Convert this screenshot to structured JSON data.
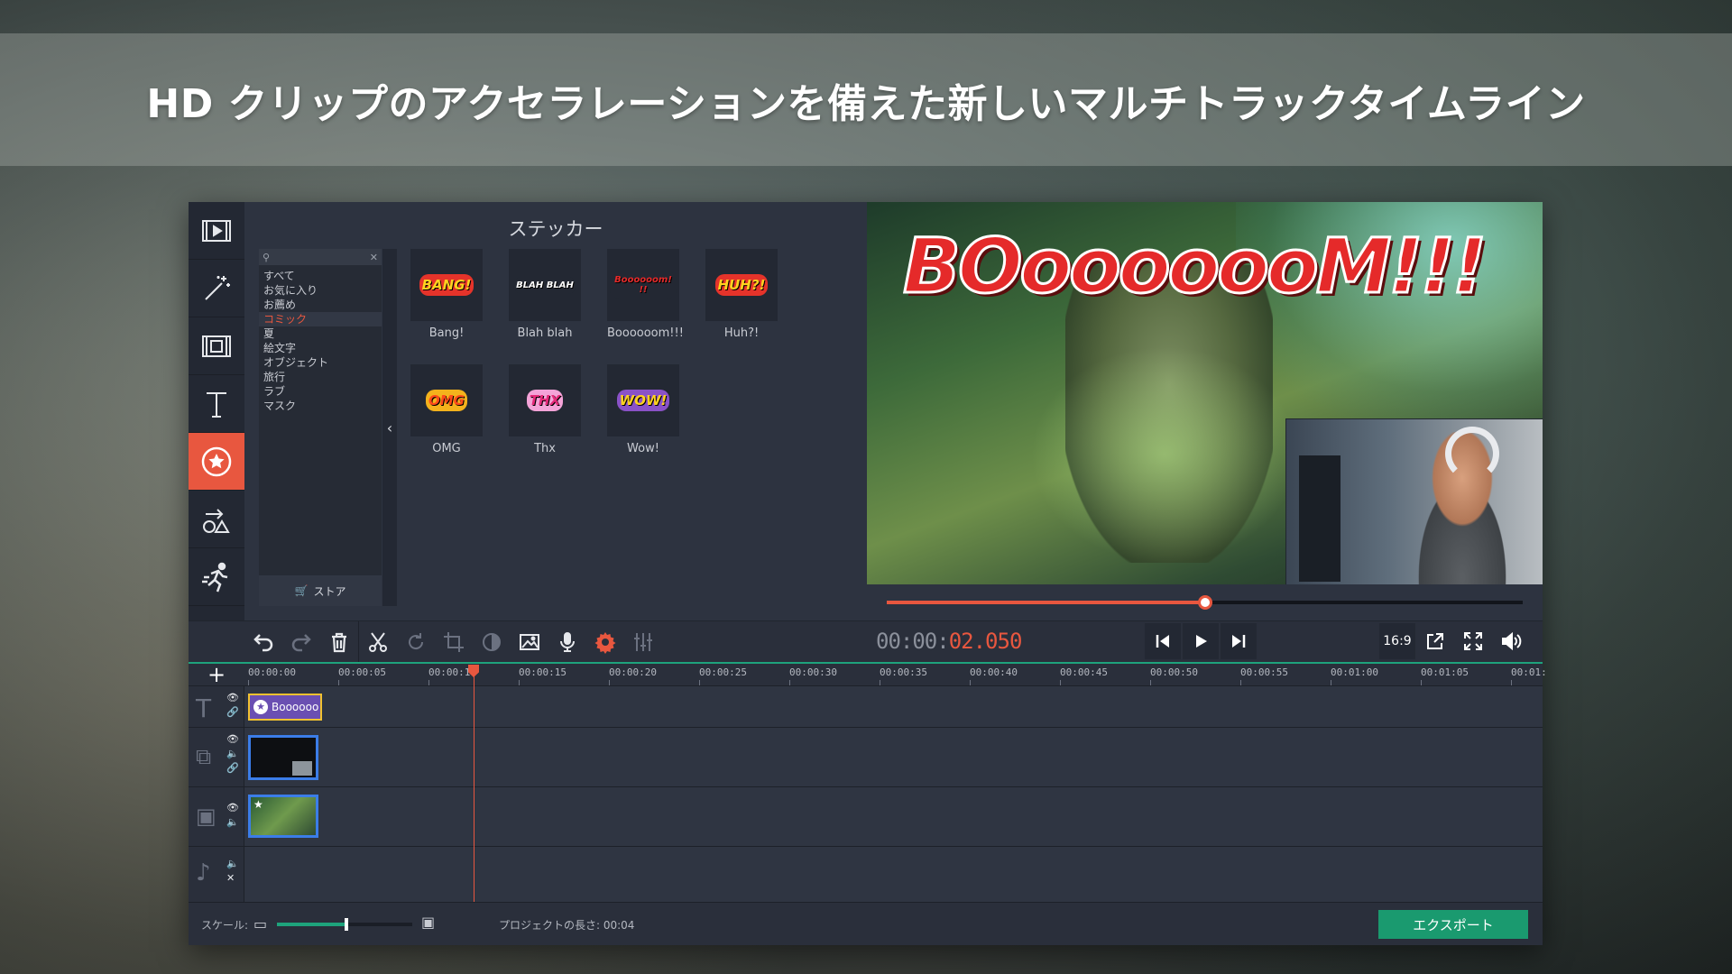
{
  "banner": {
    "headline": "HD クリップのアクセラレーションを備えた新しいマルチトラックタイムライン"
  },
  "rail": {
    "items": [
      {
        "name": "media-import",
        "icon": "film-import-icon",
        "active": false
      },
      {
        "name": "filters",
        "icon": "magic-wand-icon",
        "active": false
      },
      {
        "name": "transitions",
        "icon": "film-transition-icon",
        "active": false
      },
      {
        "name": "titles",
        "icon": "text-icon",
        "active": false
      },
      {
        "name": "stickers",
        "icon": "sticker-icon",
        "active": true
      },
      {
        "name": "shapes",
        "icon": "shapes-icon",
        "active": false
      },
      {
        "name": "motion",
        "icon": "running-figure-icon",
        "active": false
      },
      {
        "name": "more",
        "icon": "list-icon",
        "active": false
      }
    ]
  },
  "sticker_panel": {
    "title": "ステッカー",
    "search_placeholder": "",
    "categories": [
      "すべて",
      "お気に入り",
      "お薦め",
      "コミック",
      "夏",
      "絵文字",
      "オブジェクト",
      "旅行",
      "ラブ",
      "マスク"
    ],
    "active_category": "コミック",
    "store_label": "ストア",
    "stickers": [
      {
        "name": "Bang!",
        "art": "BANG!",
        "fg": "#ffd21f",
        "bg": "#e5332a"
      },
      {
        "name": "Blah blah",
        "art": "BLAH BLAH",
        "fg": "#ffffff",
        "bg": "#232833"
      },
      {
        "name": "Boooooom!!!",
        "art": "Boooooom!!!",
        "fg": "#e52a2a",
        "bg": "#232833"
      },
      {
        "name": "Huh?!",
        "art": "HUH?!",
        "fg": "#ffd21f",
        "bg": "#e5332a"
      },
      {
        "name": "OMG",
        "art": "OMG",
        "fg": "#ff4a1a",
        "bg": "#f4b21c"
      },
      {
        "name": "Thx",
        "art": "THX",
        "fg": "#e52a7a",
        "bg": "#f4a3d8"
      },
      {
        "name": "Wow!",
        "art": "WOW!",
        "fg": "#ffd21f",
        "bg": "#8a52c7"
      }
    ]
  },
  "preview": {
    "overlay_text": "BOooooooM!!!",
    "progress": 0.5
  },
  "toolbar": {
    "tools": [
      {
        "name": "undo",
        "icon": "undo-icon",
        "enabled": true
      },
      {
        "name": "redo",
        "icon": "redo-icon",
        "enabled": false
      },
      {
        "name": "delete",
        "icon": "trash-icon",
        "enabled": true
      },
      {
        "name": "cut",
        "icon": "scissors-icon",
        "enabled": true
      },
      {
        "name": "rotate",
        "icon": "rotate-icon",
        "enabled": false
      },
      {
        "name": "crop",
        "icon": "crop-icon",
        "enabled": false
      },
      {
        "name": "color-adjust",
        "icon": "contrast-icon",
        "enabled": false
      },
      {
        "name": "image",
        "icon": "image-icon",
        "enabled": true
      },
      {
        "name": "record-audio",
        "icon": "microphone-icon",
        "enabled": true
      },
      {
        "name": "clip-properties",
        "icon": "gear-icon",
        "enabled": true,
        "accent": true
      },
      {
        "name": "equalizer",
        "icon": "equalizer-icon",
        "enabled": false
      }
    ]
  },
  "playback": {
    "timecode_dim": "00:00:",
    "timecode_active": "02.050",
    "aspect_ratio": "16:9"
  },
  "timeline": {
    "ruler_ticks": [
      "00:00:00",
      "00:00:05",
      "00:00:10",
      "00:00:15",
      "00:00:20",
      "00:00:25",
      "00:00:30",
      "00:00:35",
      "00:00:40",
      "00:00:45",
      "00:00:50",
      "00:00:55",
      "00:01:00",
      "00:01:05",
      "00:01:"
    ],
    "title_clip_label": "Boooooo"
  },
  "footer": {
    "scale_label": "スケール:",
    "zoom_level": 0.5,
    "project_length_label": "プロジェクトの長さ: 00:04",
    "export_label": "エクスポート"
  },
  "colors": {
    "accent": "#e8573f",
    "export_green": "#1a9a6f",
    "timeline_green": "#1ea37c",
    "title_clip": "#6a4fb2",
    "clip_border_yellow": "#f2c230",
    "clip_border_blue": "#3b7de8"
  }
}
